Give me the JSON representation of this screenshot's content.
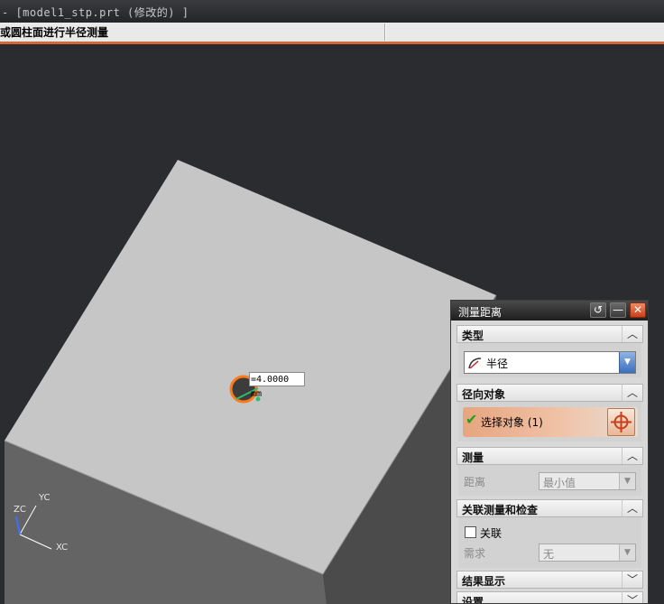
{
  "window": {
    "title": "- [model1_stp.prt  (修改的) ]"
  },
  "cue_line": {
    "text": "或圆柱面进行半径测量"
  },
  "graphics": {
    "measure_label": "=4.0000 mm",
    "axes": {
      "x": "XC",
      "y": "YC",
      "z": "ZC"
    }
  },
  "dialog": {
    "title": "测量距离",
    "title_buttons": {
      "reset": "↺",
      "minimize": "—",
      "close": "✕"
    },
    "sections": {
      "type": {
        "header": "类型",
        "value": "半径"
      },
      "radial_object": {
        "header": "径向对象",
        "select_label": "选择对象 (1)"
      },
      "measure": {
        "header": "测量",
        "distance_label": "距离",
        "distance_value": "最小值"
      },
      "associative": {
        "header": "关联测量和检查",
        "associative_label": "关联",
        "requirement_label": "需求",
        "requirement_value": "无"
      },
      "result_display": {
        "header": "结果显示"
      },
      "settings": {
        "header": "设置"
      }
    }
  },
  "colors": {
    "accent": "#cf6a3a",
    "face_top": "#c6c6c6",
    "face_front": "#646464",
    "face_side": "#4b4b4b",
    "background": "#2b2c2f"
  }
}
